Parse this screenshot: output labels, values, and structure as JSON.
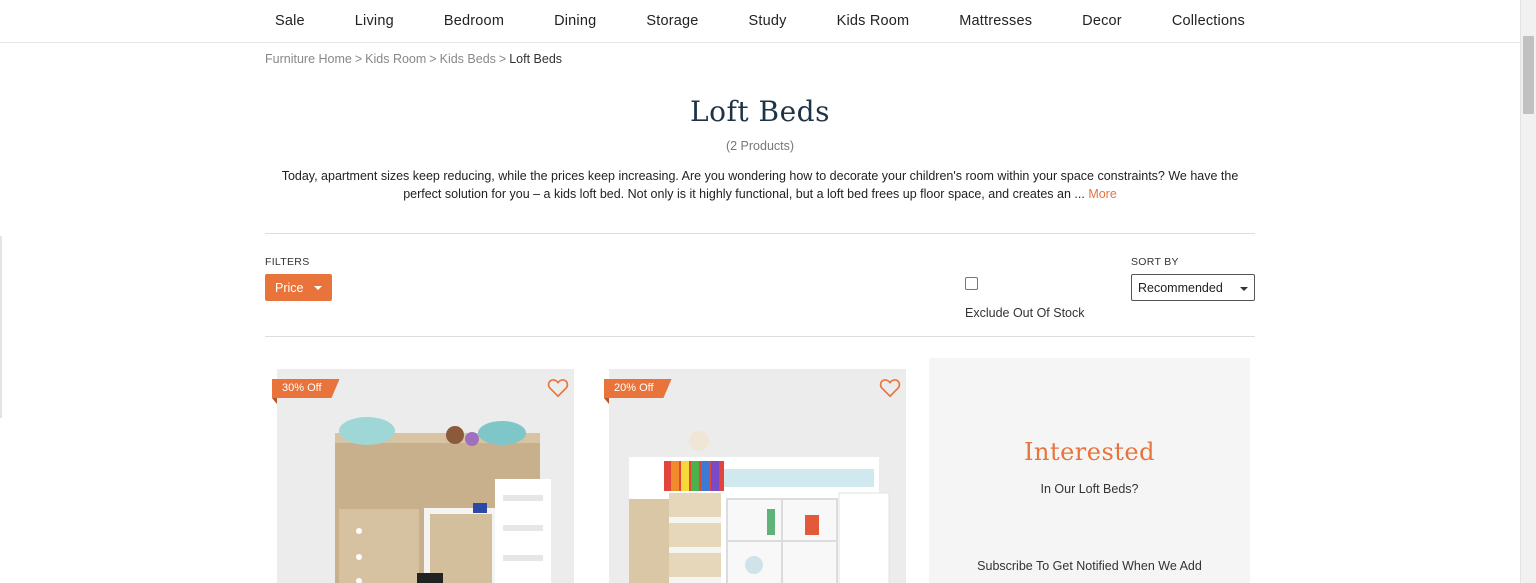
{
  "nav": {
    "items": [
      "Sale",
      "Living",
      "Bedroom",
      "Dining",
      "Storage",
      "Study",
      "Kids Room",
      "Mattresses",
      "Decor",
      "Collections"
    ]
  },
  "breadcrumb": {
    "items": [
      "Furniture Home",
      "Kids Room",
      "Kids Beds"
    ],
    "separator": ">",
    "current": "Loft Beds"
  },
  "page": {
    "title": "Loft Beds",
    "count": "(2 Products)",
    "description": "Today, apartment sizes keep reducing, while the prices keep increasing. Are you wondering how to decorate your children's room within your space constraints? We have the perfect solution for you – a kids loft bed. Not only is it highly functional, but a loft bed frees up floor space, and creates an ...",
    "more_label": "More"
  },
  "filters": {
    "label": "FILTERS",
    "price_label": "Price",
    "exclude_label": "Exclude Out Of Stock",
    "exclude_checked": false
  },
  "sort": {
    "label": "SORT BY",
    "selected": "Recommended"
  },
  "products": [
    {
      "badge": "30% Off"
    },
    {
      "badge": "20% Off"
    }
  ],
  "interest": {
    "title": "Interested",
    "subtitle": "In Our Loft Beds?",
    "subscribe": "Subscribe To Get Notified When We Add"
  },
  "colors": {
    "accent": "#e8743b",
    "title": "#1f3346",
    "panel_bg": "#f5f5f5"
  }
}
